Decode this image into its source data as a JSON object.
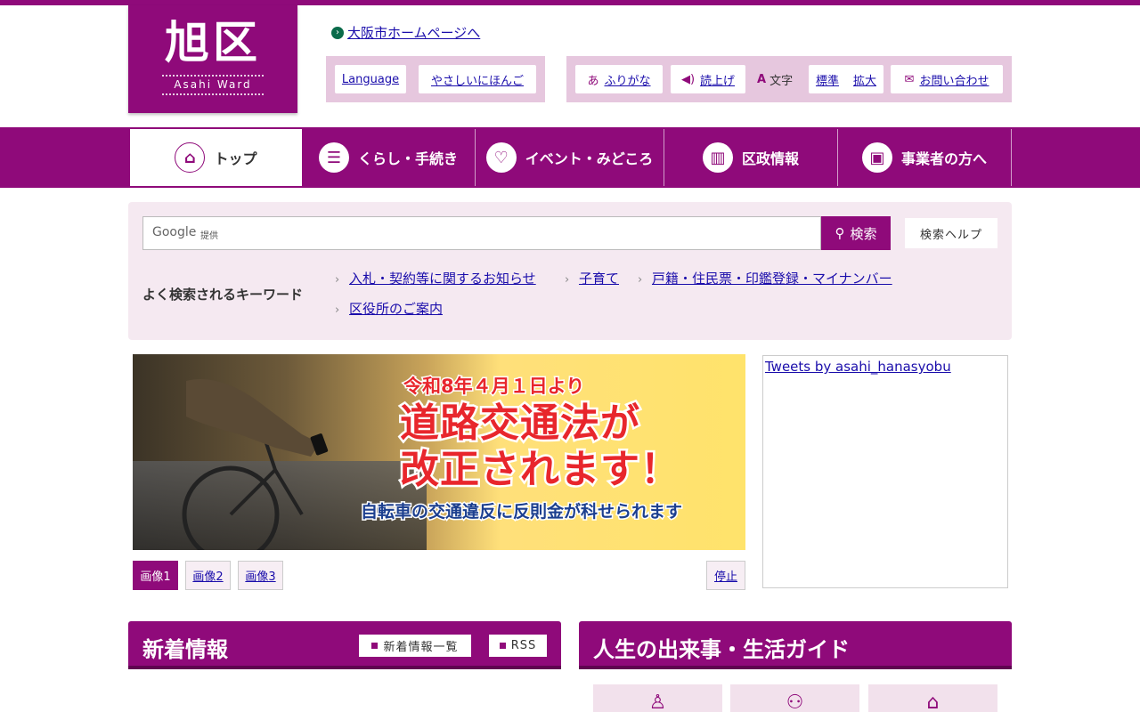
{
  "header": {
    "logo_kanji": "旭区",
    "logo_en": "Asahi Ward",
    "osaka_link": "大阪市ホームページへ",
    "lang_button": "Language",
    "easy_japanese": "やさしいにほんご",
    "furigana": "ふりがな",
    "read_aloud": "読上げ",
    "text_size_label": "文字",
    "text_standard": "標準",
    "text_large": "拡大",
    "contact": "お問い合わせ"
  },
  "nav": {
    "items": [
      {
        "label": "トップ"
      },
      {
        "label": "くらし・手続き"
      },
      {
        "label": "イベント・みどころ"
      },
      {
        "label": "区政情報"
      },
      {
        "label": "事業者の方へ"
      }
    ]
  },
  "search": {
    "google_label": "Google",
    "placeholder": "提供",
    "button": "検索",
    "help": "検索ヘルプ",
    "keywords_label": "よく検索されるキーワード",
    "keywords": [
      "入札・契約等に関するお知らせ",
      "子育て",
      "戸籍・住民票・印鑑登録・マイナンバー",
      "区役所のご案内"
    ]
  },
  "slideshow": {
    "line1": "令和8年４月１日より",
    "line2": "道路交通法が",
    "line3": "改正されます！",
    "line4": "自転車の交通違反に反則金が科せられます",
    "buttons": [
      "画像1",
      "画像2",
      "画像3"
    ],
    "stop": "停止",
    "active_index": 0
  },
  "tweets": {
    "link": "Tweets by asahi_hanasyobu"
  },
  "news": {
    "title": "新着情報",
    "list_button": "新着情報一覧",
    "rss_button": "RSS"
  },
  "life": {
    "title": "人生の出来事・生活ガイド"
  },
  "colors": {
    "brand": "#8f0a7a",
    "brand_light": "#e6c7de",
    "search_bg": "#f5e9f1"
  }
}
